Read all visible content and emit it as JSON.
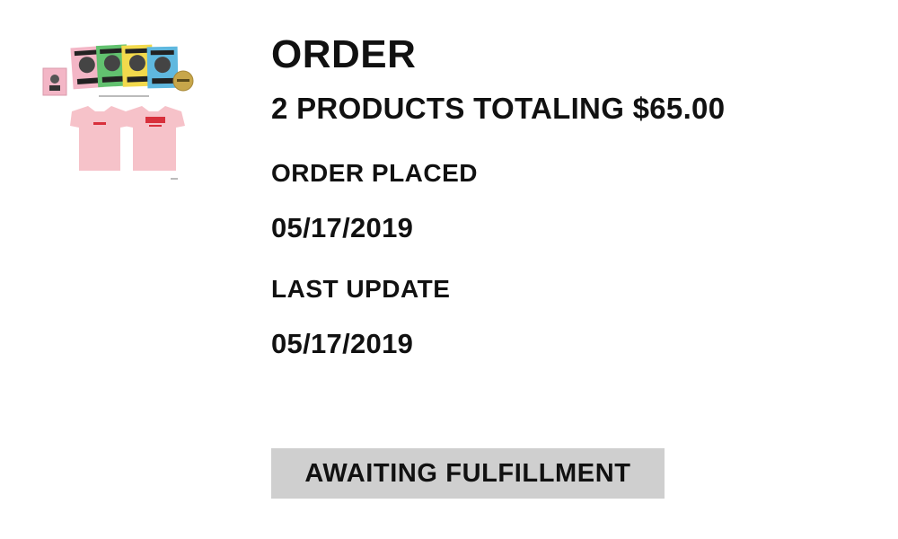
{
  "product_image": {
    "icon": "merch-bundle-thumbnail",
    "colors": {
      "pink": "#f3b6c6",
      "green": "#62c16f",
      "yellow": "#f2d94c",
      "blue": "#5fb8df",
      "gold": "#c7a64a",
      "shirt": "#f6c2c9",
      "shirt_text": "#d8303c"
    }
  },
  "order": {
    "heading": "ORDER",
    "summary": "2 PRODUCTS TOTALING $65.00",
    "placed_label": "ORDER PLACED",
    "placed_date": "05/17/2019",
    "updated_label": "LAST UPDATE",
    "updated_date": "05/17/2019",
    "status": "AWAITING FULFILLMENT"
  },
  "status_badge": {
    "background": "#cfcfcf"
  }
}
